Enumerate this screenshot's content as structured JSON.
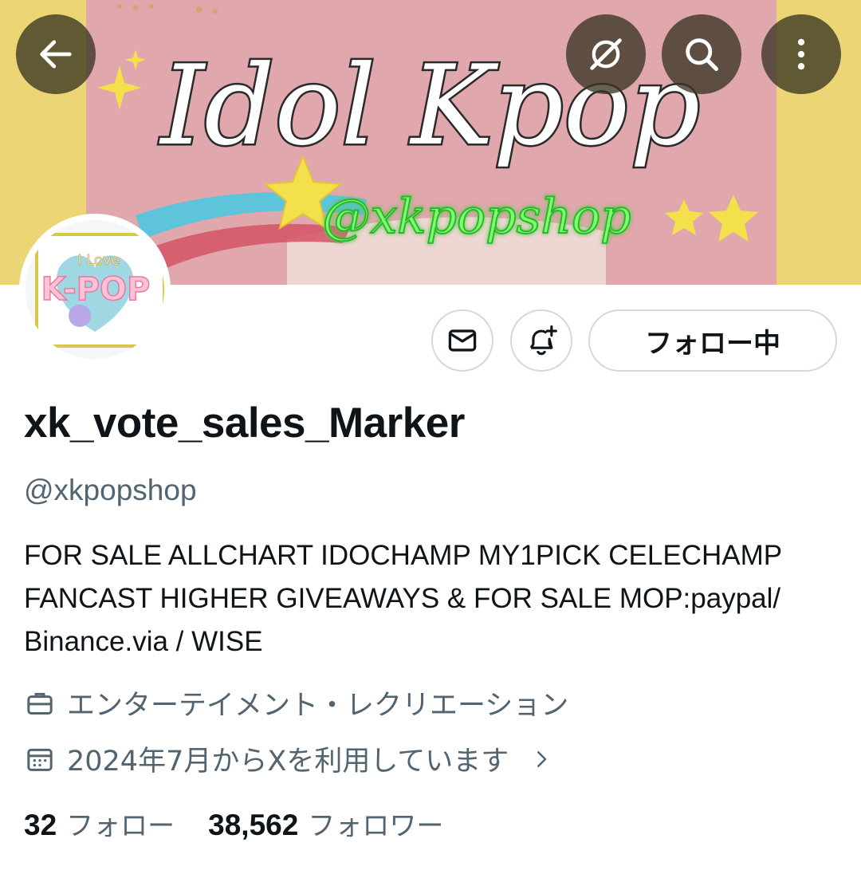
{
  "banner": {
    "title": "Idol Kpop",
    "handle_text": "@xkpopshop",
    "colors": {
      "border": "#ecd574",
      "panel": "#e0a8ac",
      "title_fill": "#ffffff",
      "handle_glow": "#5cf05c",
      "star": "#f4e04a"
    }
  },
  "header_buttons": {
    "back_icon": "arrow-left-icon",
    "grok_icon": "grok-icon",
    "search_icon": "search-icon",
    "more_icon": "more-vertical-icon"
  },
  "avatar": {
    "small_text": "I Love",
    "big_text": "K-POP"
  },
  "actions": {
    "message_icon": "envelope-icon",
    "notify_icon": "bell-plus-icon",
    "follow_state_label": "フォロー中"
  },
  "profile": {
    "display_name": "xk_vote_sales_Marker",
    "handle": "@xkpopshop",
    "bio": "FOR SALE ALLCHART IDOCHAMP MY1PICK CELECHAMP FANCAST HIGHER GIVEAWAYS & FOR SALE MOP:paypal/ Binance.via / WISE",
    "category": "エンターテイメント・レクリエーション",
    "joined": "2024年7月からXを利用しています"
  },
  "stats": {
    "following_count": "32",
    "following_label": "フォロー",
    "followers_count": "38,562",
    "followers_label": "フォロワー"
  },
  "colors": {
    "primary_text": "#0f1419",
    "secondary_text": "#536471",
    "border": "#cfd9de"
  }
}
